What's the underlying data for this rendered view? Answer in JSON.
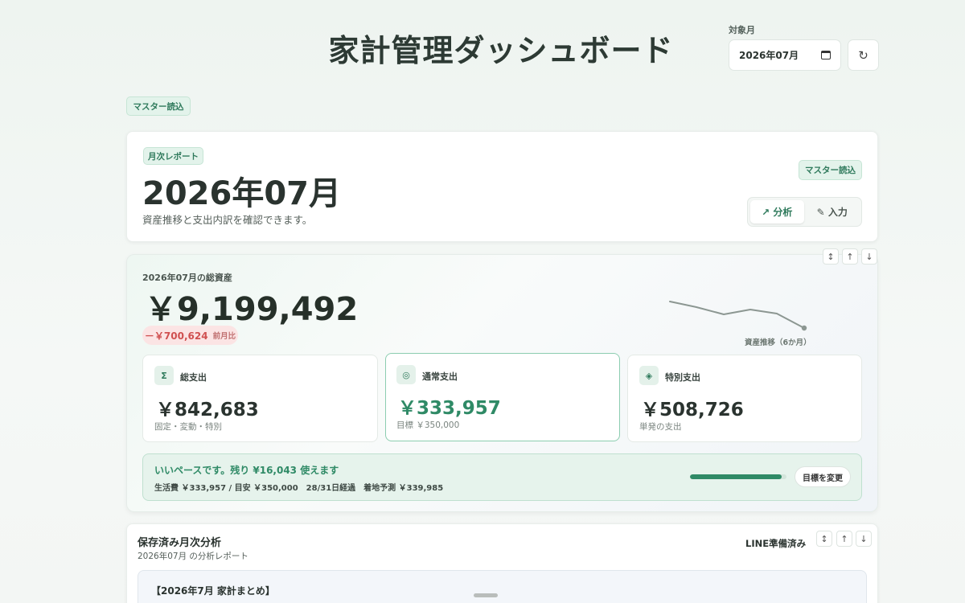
{
  "header": {
    "title": "家計管理ダッシュボード",
    "month_label": "対象月",
    "month_value": "2026年07月",
    "refresh_icon": "refresh-icon"
  },
  "master_button": "マスター読込",
  "report": {
    "chip": "月次レポート",
    "title": "2026年07月",
    "subtitle": "資産推移と支出内訳を確認できます。",
    "master_button": "マスター読込",
    "tabs": [
      "↗ 分析",
      "✎ 入力"
    ],
    "active_tab": "↗ 分析"
  },
  "assets": {
    "label": "2026年07月の総資産",
    "value": "￥9,199,492",
    "diff_value": "－￥700,624",
    "diff_label": "前月比",
    "trend_label": "資産推移（6か月）",
    "controls": [
      "↕",
      "↑",
      "↓"
    ],
    "stats": [
      {
        "icon": "Σ",
        "title": "総支出",
        "value": "￥842,683",
        "sub": "固定・変動・特別"
      },
      {
        "icon": "◎",
        "title": "通常支出",
        "value": "￥333,957",
        "sub": "目標 ￥350,000"
      },
      {
        "icon": "◈",
        "title": "特別支出",
        "value": "￥508,726",
        "sub": "単発の支出"
      }
    ],
    "pace": {
      "title": "いいペースです。残り ¥16,043 使えます",
      "sub": "生活費 ￥333,957 / 目安 ￥350,000　28/31日経過　着地予測 ￥339,985",
      "progress": 0.954,
      "button": "目標を変更"
    }
  },
  "saved": {
    "title": "保存済み月次分析",
    "subtitle": "2026年07月 の分析レポート",
    "line_status": "LINE準備済み",
    "controls": [
      "↕",
      "↑",
      "↓"
    ],
    "summary_title": "【2026年7月 家計まとめ】"
  },
  "colors": {
    "accent": "#2f8a66",
    "negative": "#d05050",
    "background": "#eef4f0"
  }
}
